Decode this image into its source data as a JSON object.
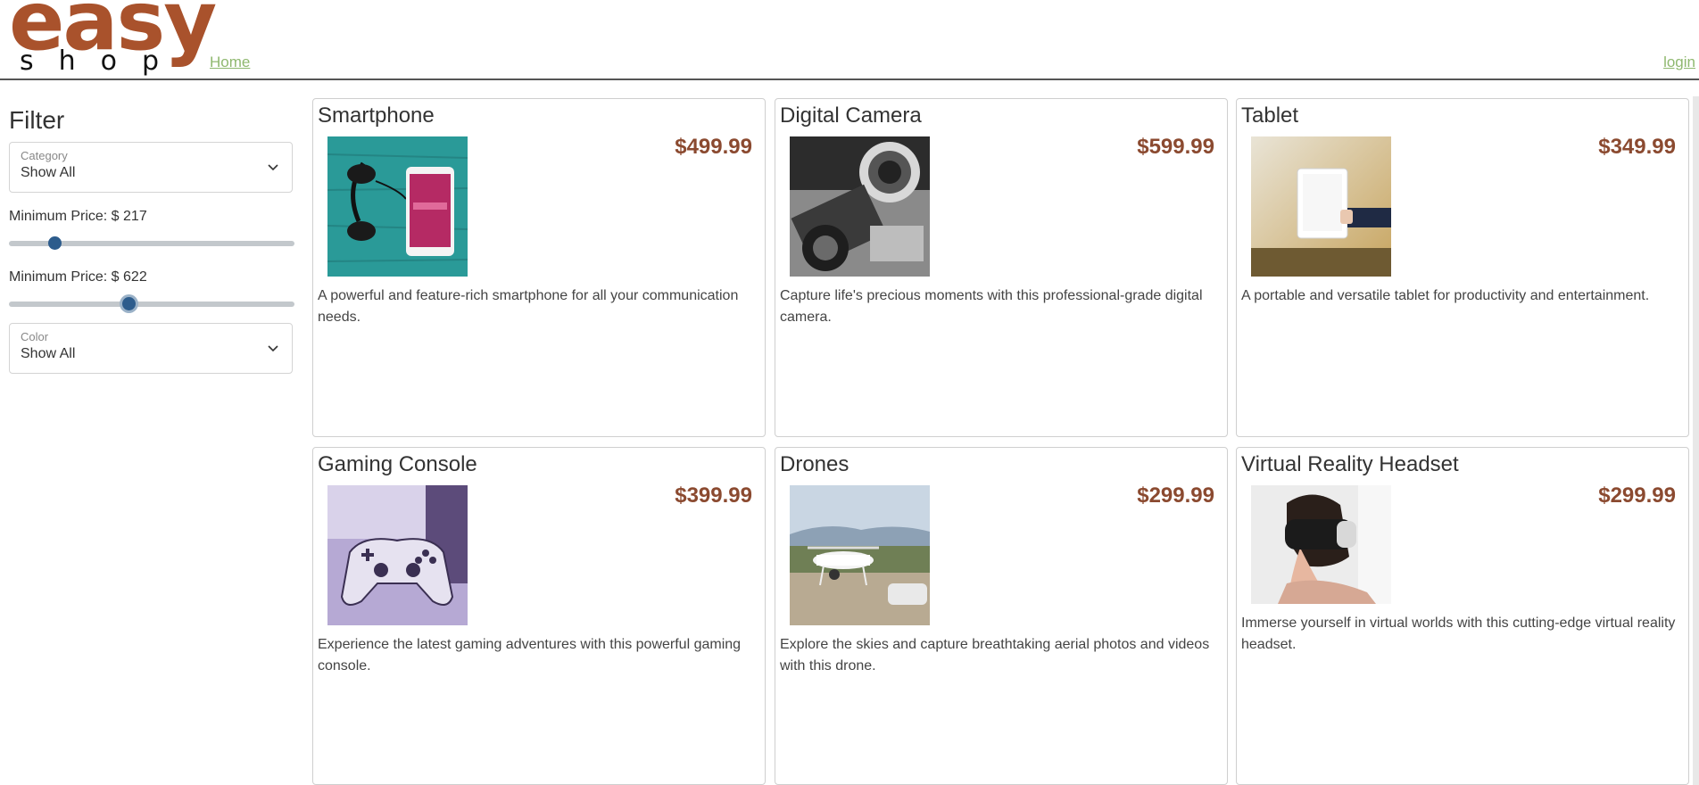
{
  "header": {
    "logo_top": "easy",
    "logo_bottom": "shop",
    "home_link": "Home",
    "login_link": "login"
  },
  "colors": {
    "brand": "#a9522c",
    "price": "#8b4a30",
    "link": "#8fb86f",
    "slider_thumb": "#2d5c8c"
  },
  "sidebar": {
    "title": "Filter",
    "category": {
      "label": "Category",
      "value": "Show All"
    },
    "min_price": {
      "label": "Minimum Price: $ 217",
      "value_fraction": 0.16
    },
    "max_price": {
      "label": "Minimum Price: $ 622",
      "value_fraction": 0.42
    },
    "color": {
      "label": "Color",
      "value": "Show All"
    }
  },
  "products": [
    {
      "name": "Smartphone",
      "price": "$499.99",
      "description": "A powerful and feature-rich smartphone for all your communication needs."
    },
    {
      "name": "Digital Camera",
      "price": "$599.99",
      "description": "Capture life's precious moments with this professional-grade digital camera."
    },
    {
      "name": "Tablet",
      "price": "$349.99",
      "description": "A portable and versatile tablet for productivity and entertainment."
    },
    {
      "name": "Gaming Console",
      "price": "$399.99",
      "description": "Experience the latest gaming adventures with this powerful gaming console."
    },
    {
      "name": "Drones",
      "price": "$299.99",
      "description": "Explore the skies and capture breathtaking aerial photos and videos with this drone."
    },
    {
      "name": "Virtual Reality Headset",
      "price": "$299.99",
      "description": "Immerse yourself in virtual worlds with this cutting-edge virtual reality headset."
    }
  ]
}
